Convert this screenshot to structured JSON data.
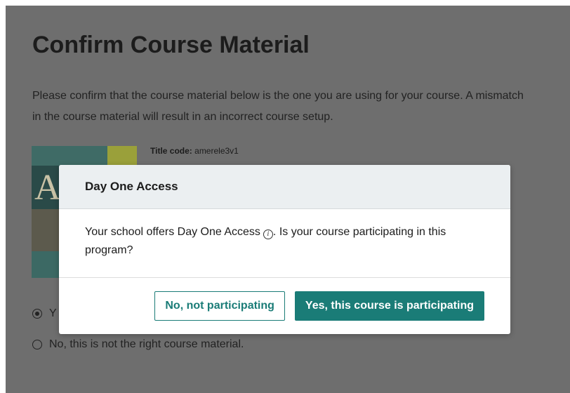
{
  "page": {
    "title": "Confirm Course Material",
    "intro": "Please confirm that the course material below is the one you are using for your course. A mismatch in the course material will result in an incorrect course setup.",
    "title_code_label": "Title code:",
    "title_code_value": "amerele3v1",
    "cover_letter": "A",
    "radio_yes_label": "Y",
    "radio_no_label": "No, this is not the right course material.",
    "background_color": "#6e6e6e"
  },
  "modal": {
    "title": "Day One Access",
    "body_part1": "Your school offers Day One Access",
    "body_part2": ". Is your course participating in this program?",
    "info_icon": "info-icon",
    "secondary_button": "No, not participating",
    "primary_button": "Yes, this course is participating",
    "accent_color": "#1a7c77"
  }
}
